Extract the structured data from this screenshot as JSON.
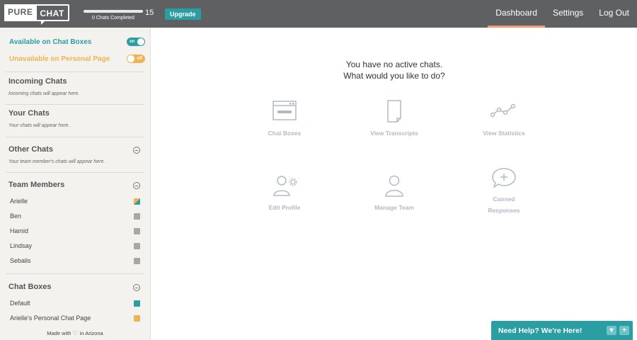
{
  "header": {
    "logo_pure": "PURE",
    "logo_chat": "CHAT",
    "progress_caption": "0 Chats Completed",
    "progress_fraction": 0,
    "progress_total": "15",
    "upgrade_label": "Upgrade",
    "nav": [
      "Dashboard",
      "Settings",
      "Log Out"
    ],
    "active_nav": "Dashboard",
    "accent_color": "#f29a76"
  },
  "sidebar": {
    "available_label": "Available on Chat Boxes",
    "available_toggle": "on",
    "unavailable_label": "Unavailable on Personal Page",
    "unavailable_toggle": "off",
    "incoming_title": "Incoming Chats",
    "incoming_note": "Incoming chats will appear here.",
    "your_title": "Your Chats",
    "your_note": "Your chats will appear here.",
    "other_title": "Other Chats",
    "other_note": "Your team member's chats will appear here.",
    "team_title": "Team Members",
    "team": [
      {
        "name": "Arielle",
        "color": "mixed"
      },
      {
        "name": "Ben",
        "color": "#a8a7a4"
      },
      {
        "name": "Hamid",
        "color": "#a8a7a4"
      },
      {
        "name": "Lindsay",
        "color": "#a8a7a4"
      },
      {
        "name": "Sebalis",
        "color": "#a8a7a4"
      }
    ],
    "boxes_title": "Chat Boxes",
    "boxes": [
      {
        "name": "Default",
        "color": "#2a9ea3"
      },
      {
        "name": "Arielle's Personal Chat Page",
        "color": "#f0b353"
      }
    ],
    "footer_pre": "Made with",
    "footer_post": "in Arizona"
  },
  "main": {
    "line1": "You have no active chats.",
    "line2": "What would you like to do?",
    "tiles": [
      {
        "label": "Chat Boxes",
        "icon": "browser-window-icon"
      },
      {
        "label": "View Transcripts",
        "icon": "document-icon"
      },
      {
        "label": "View Statistics",
        "icon": "line-graph-icon"
      },
      {
        "label": "Edit Profile",
        "icon": "user-gear-icon"
      },
      {
        "label": "Manage Team",
        "icon": "user-icon"
      },
      {
        "label": "Canned Responses",
        "icon": "speech-bubble-plus-icon"
      }
    ]
  },
  "help": {
    "label": "Need Help? We're Here!",
    "minimize": "▾",
    "expand": "+"
  }
}
